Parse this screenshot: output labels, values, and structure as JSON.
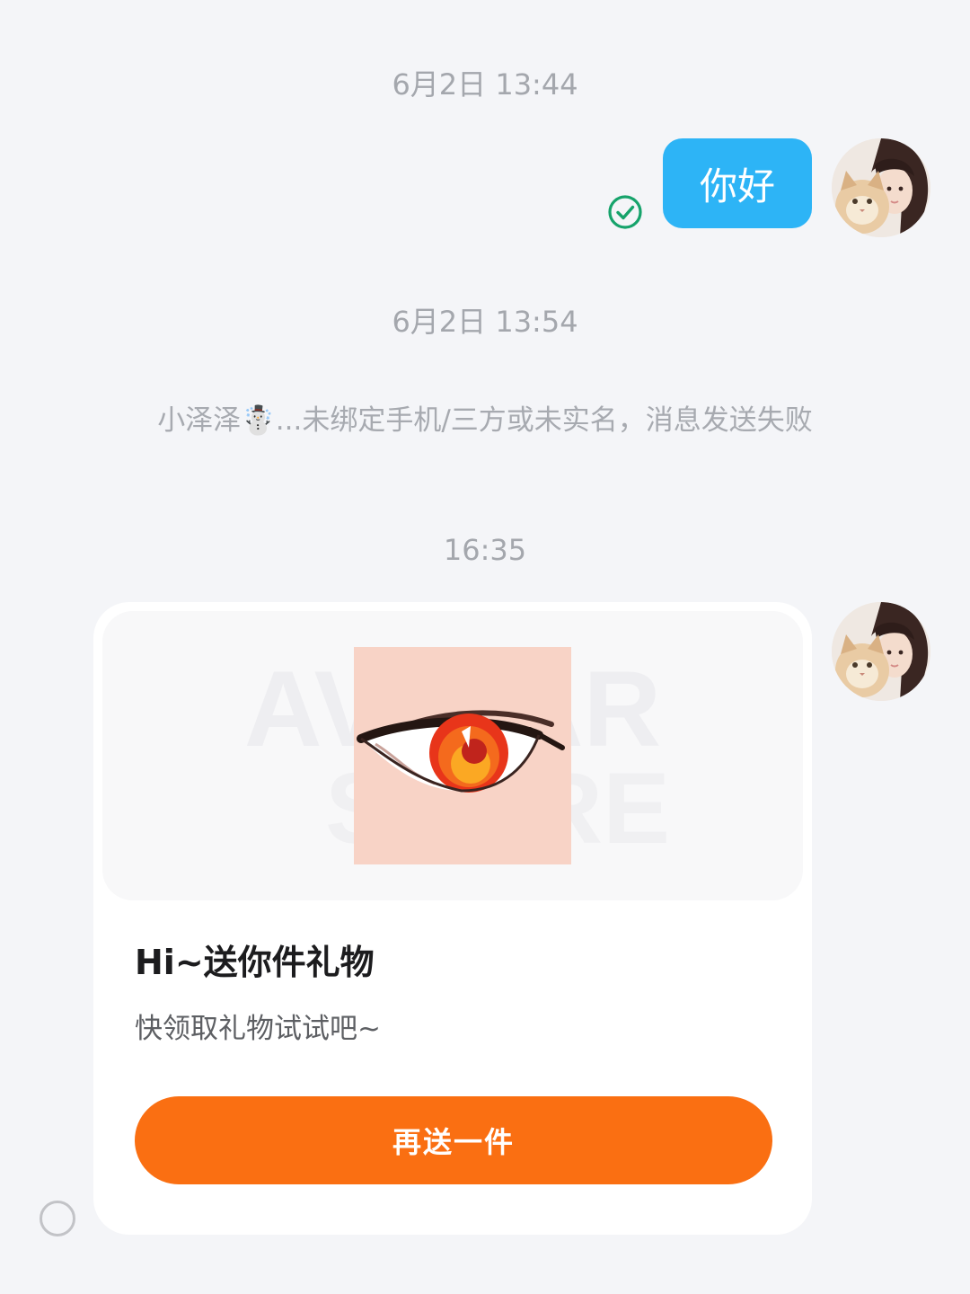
{
  "timestamps": [
    "6月2日 13:44",
    "6月2日 13:54",
    "16:35"
  ],
  "outgoing_message": {
    "text": "你好",
    "status_icon": "check-circle-icon",
    "status_color": "#16a36b"
  },
  "system_notice": {
    "name": "小泽泽",
    "emoji": "☃️",
    "text": "...未绑定手机/三方或未实名，消息发送失败"
  },
  "gift_card": {
    "title": "Hi~送你件礼物",
    "subtitle": "快领取礼物试试吧~",
    "button_label": "再送一件",
    "button_color": "#fa6f12",
    "watermark_line1": "AVATAR",
    "watermark_line2": "STORE"
  },
  "colors": {
    "bubble": "#2db4f6",
    "background": "#f4f5f8"
  }
}
